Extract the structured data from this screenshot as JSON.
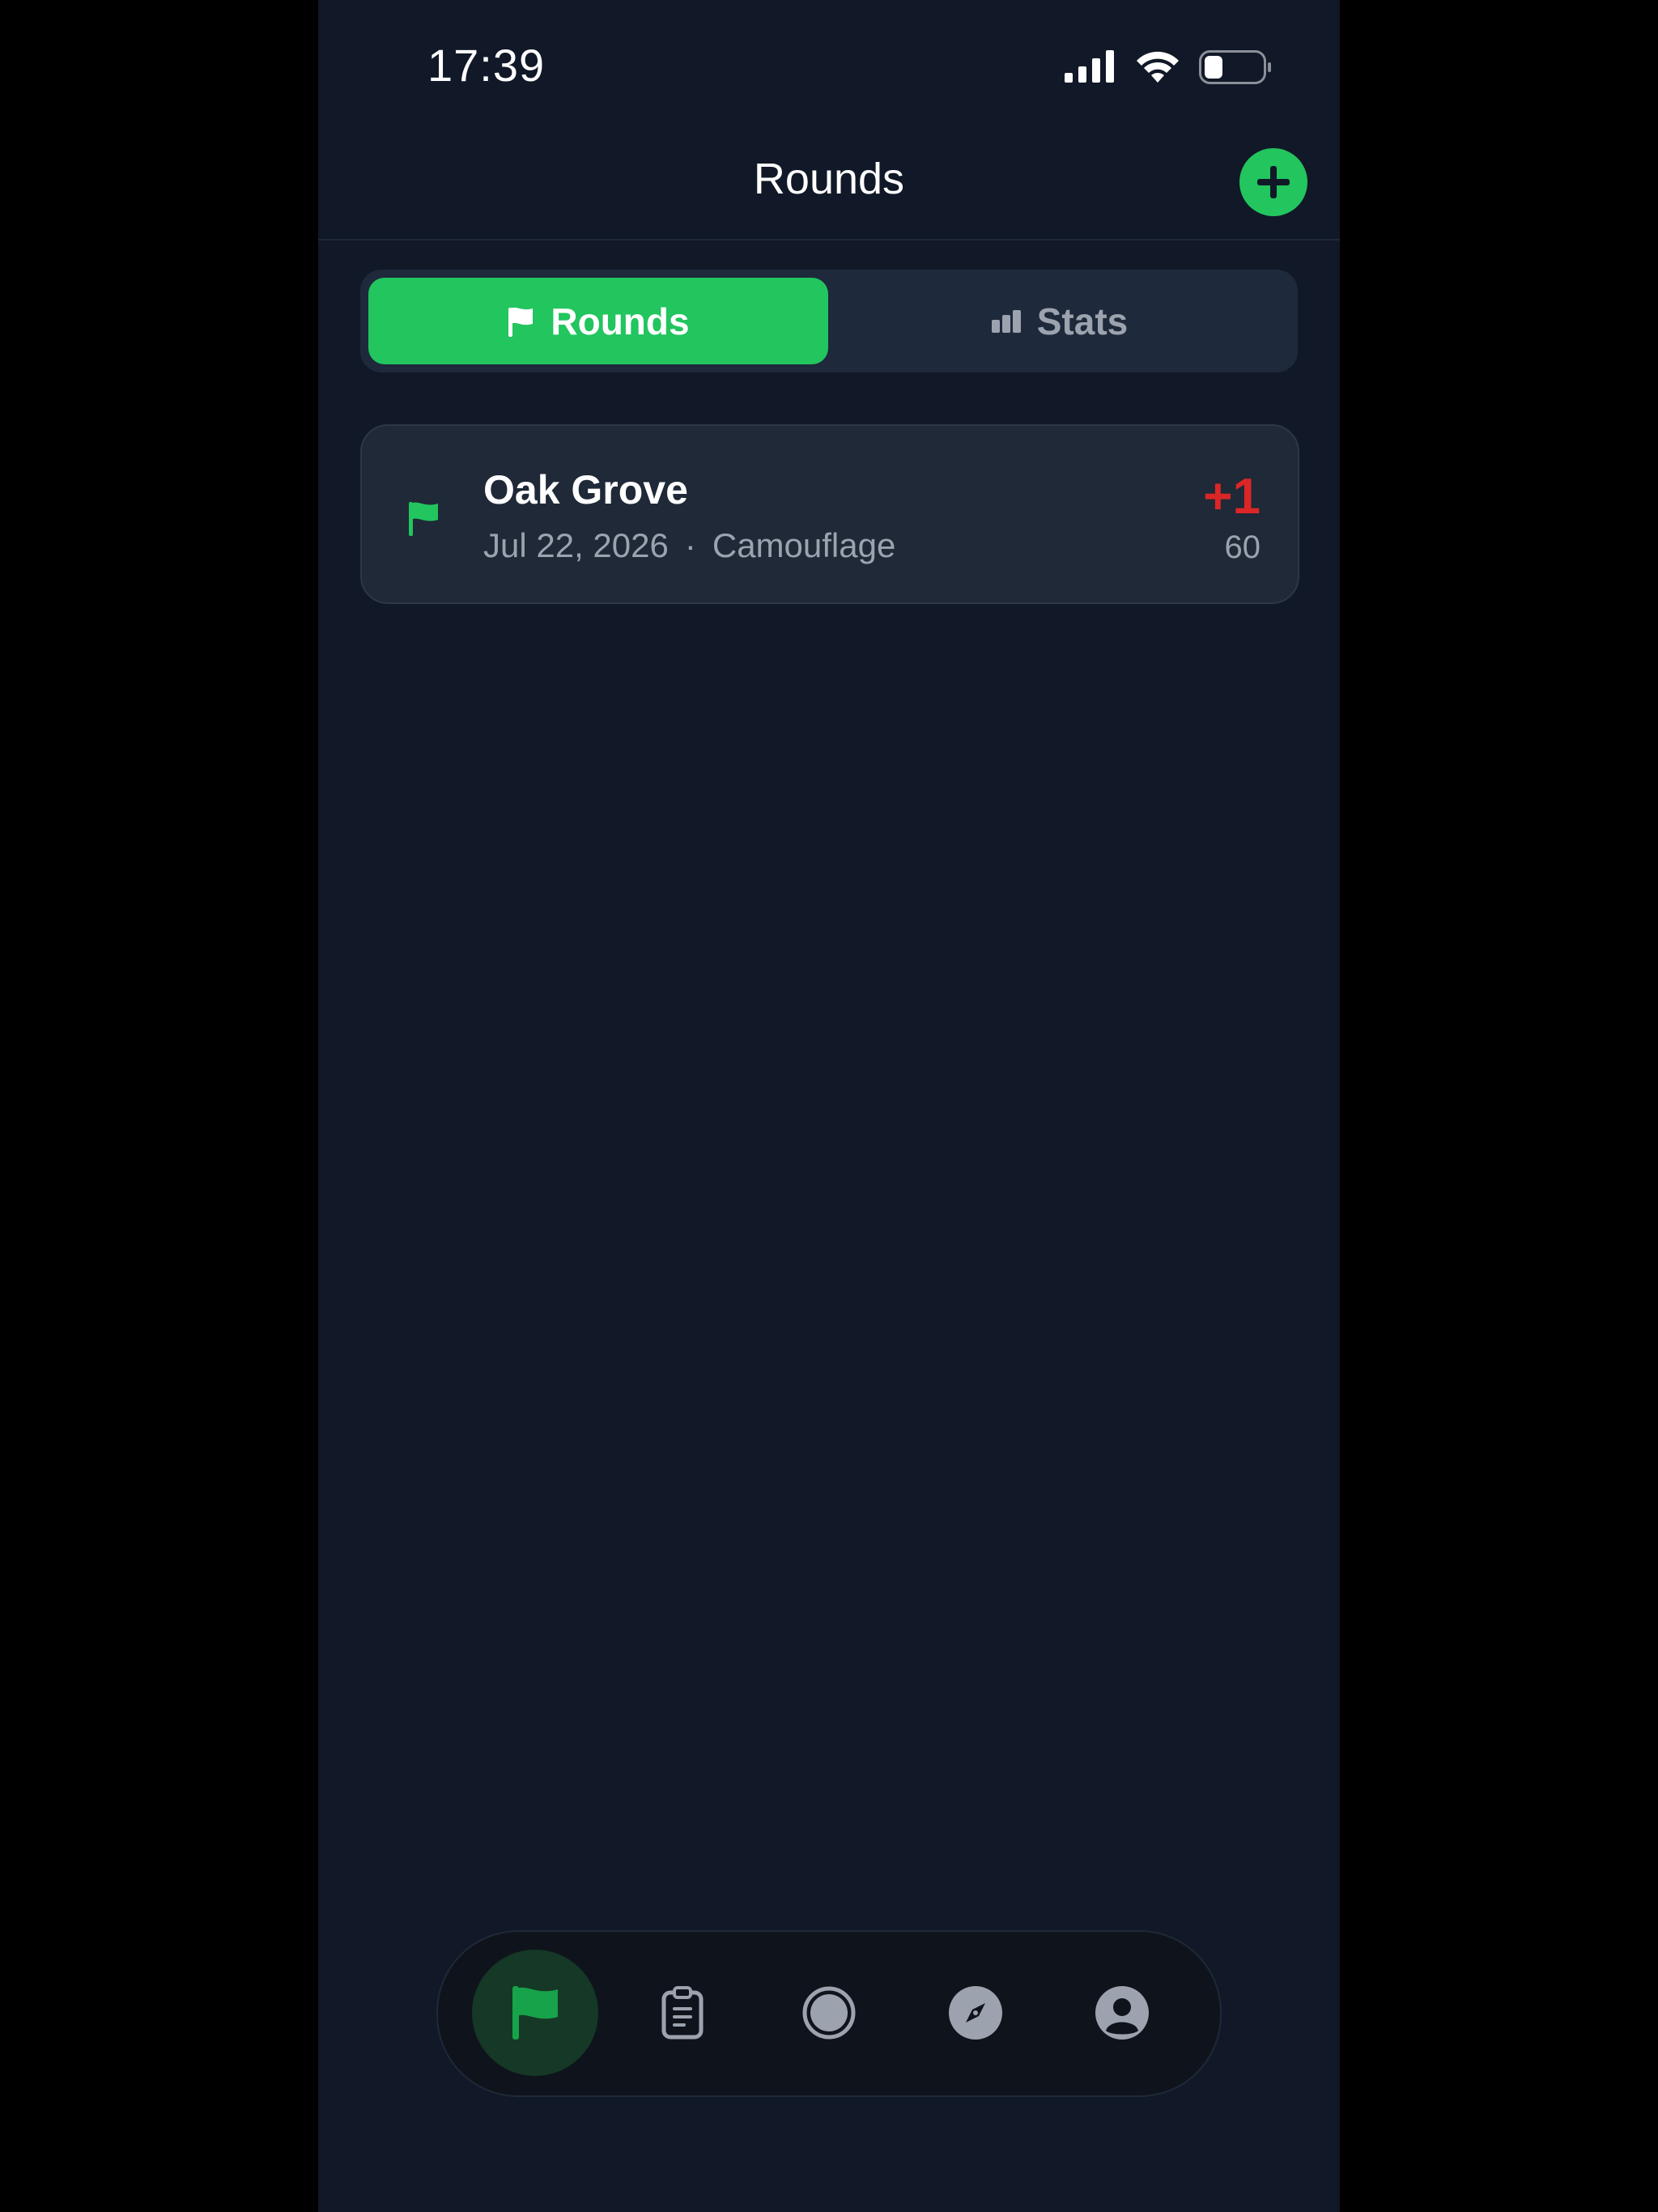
{
  "status_bar": {
    "time": "17:39",
    "icons": [
      "signal-icon",
      "wifi-icon",
      "battery-icon"
    ]
  },
  "header": {
    "title": "Rounds",
    "add_icon": "plus-icon"
  },
  "segments": [
    {
      "label": "Rounds",
      "icon": "flag-icon",
      "active": true
    },
    {
      "label": "Stats",
      "icon": "bar-chart-icon",
      "active": false
    }
  ],
  "rounds": [
    {
      "course": "Oak Grove",
      "date": "Jul 22, 2026",
      "separator": "·",
      "tee": "Camouflage",
      "score_to_par": "+1",
      "total": "60"
    }
  ],
  "tab_bar": {
    "items": [
      {
        "icon": "flag-icon",
        "active": true
      },
      {
        "icon": "clipboard-icon",
        "active": false
      },
      {
        "icon": "record-icon",
        "active": false
      },
      {
        "icon": "compass-icon",
        "active": false
      },
      {
        "icon": "profile-icon",
        "active": false
      }
    ]
  },
  "colors": {
    "background": "#111827",
    "accent": "#22c55e",
    "card": "#1f2937",
    "over_par": "#dc2626",
    "muted": "#9ca3af"
  }
}
